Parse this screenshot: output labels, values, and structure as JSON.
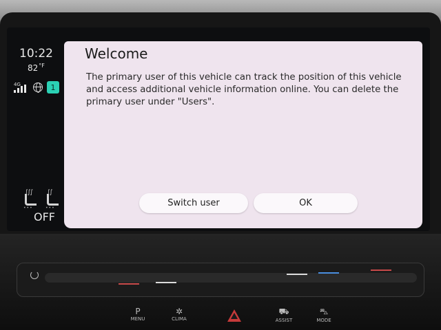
{
  "status": {
    "time": "10:22",
    "temperature": "82",
    "temperature_unit": "°F",
    "network": "4G",
    "user_badge": "1",
    "seat_status": "OFF"
  },
  "dialog": {
    "title": "Welcome",
    "message": "The primary user of this vehicle can track the position of this vehicle and access additional vehicle information online. You can delete the primary user under \"Users\".",
    "switch_user_label": "Switch user",
    "ok_label": "OK"
  },
  "console": {
    "assist_label": "ASSIST",
    "mode_label": "MODE",
    "clima_label": "CLIMA",
    "menu_label": "MENU"
  },
  "colors": {
    "badge": "#2bd1b5",
    "dialog_bg": "#efe4ee"
  }
}
